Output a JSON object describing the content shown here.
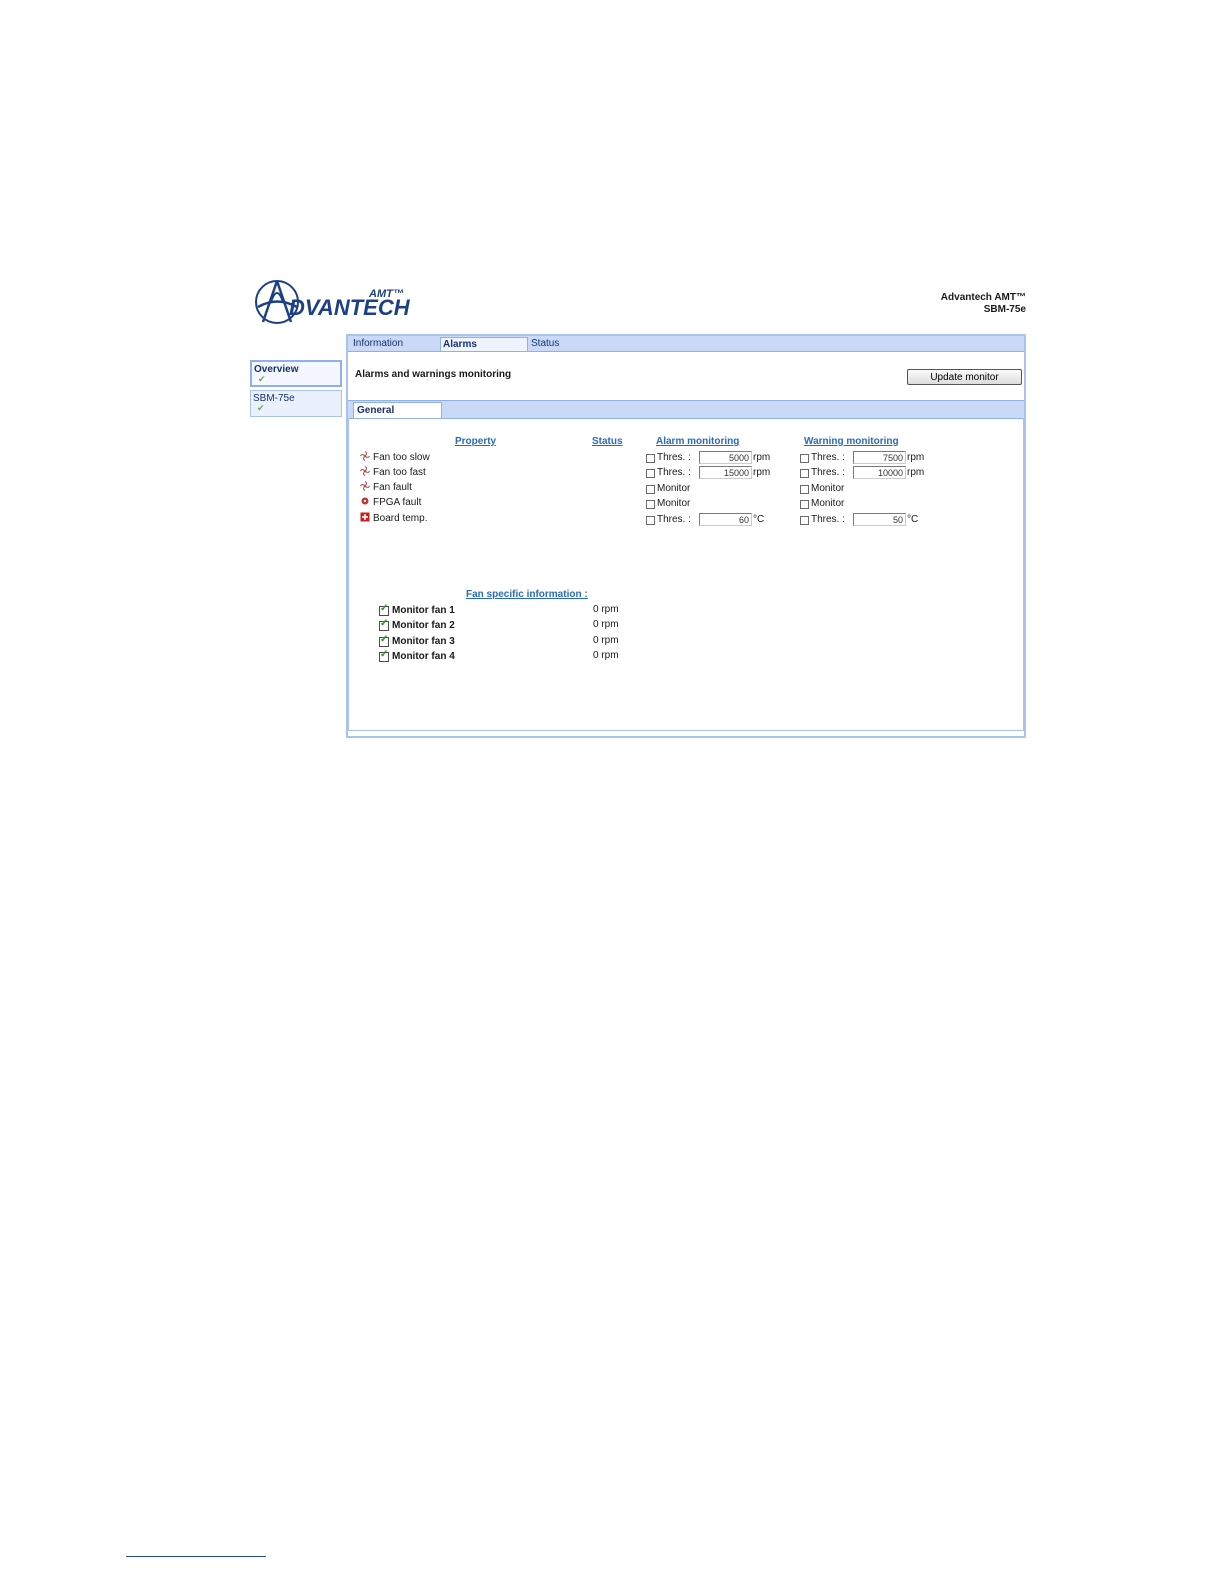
{
  "header": {
    "logo": {
      "word": "DVANTECH",
      "superscript": "AMT™"
    },
    "brand_line1": "Advantech AMT™",
    "brand_line2": "SBM-75e"
  },
  "tabs": [
    {
      "label": "Information",
      "active": false
    },
    {
      "label": "Alarms",
      "active": true
    },
    {
      "label": "Status",
      "active": false
    }
  ],
  "sidebar": {
    "items": [
      {
        "label": "Overview",
        "active": true
      },
      {
        "label": "SBM-75e",
        "active": false
      }
    ]
  },
  "main": {
    "title": "Alarms and warnings monitoring",
    "update_button": "Update monitor",
    "subtab": "General",
    "columns": {
      "property": "Property",
      "status": "Status",
      "alarm": "Alarm monitoring",
      "warning": "Warning monitoring"
    },
    "properties": [
      {
        "label": "Fan too slow",
        "icon": "fan-icon"
      },
      {
        "label": "Fan too fast",
        "icon": "fan-icon"
      },
      {
        "label": "Fan fault",
        "icon": "fan-icon"
      },
      {
        "label": "FPGA fault",
        "icon": "chip-icon"
      },
      {
        "label": "Board temp.",
        "icon": "board-temp-icon"
      }
    ],
    "alarm": [
      {
        "label": "Thres. :",
        "value": "5000",
        "unit": "rpm"
      },
      {
        "label": "Thres. :",
        "value": "15000",
        "unit": "rpm"
      },
      {
        "label": "Monitor"
      },
      {
        "label": "Monitor"
      },
      {
        "label": "Thres. :",
        "value": "60",
        "unit": "°C"
      }
    ],
    "warning": [
      {
        "label": "Thres. :",
        "value": "7500",
        "unit": "rpm"
      },
      {
        "label": "Thres. :",
        "value": "10000",
        "unit": "rpm"
      },
      {
        "label": "Monitor"
      },
      {
        "label": "Monitor"
      },
      {
        "label": "Thres. :",
        "value": "50",
        "unit": "°C"
      }
    ],
    "fan_section": {
      "title": "Fan specific information :",
      "fans": [
        {
          "label": "Monitor fan 1",
          "value": "0 rpm",
          "checked": true
        },
        {
          "label": "Monitor fan 2",
          "value": "0 rpm",
          "checked": true
        },
        {
          "label": "Monitor fan 3",
          "value": "0 rpm",
          "checked": true
        },
        {
          "label": "Monitor fan 4",
          "value": "0 rpm",
          "checked": true
        }
      ]
    }
  },
  "colors": {
    "accent": "#2a6bb8",
    "tabbar": "#c9d9f7",
    "border": "#a9c2ee",
    "brand": "#1c3f86"
  }
}
